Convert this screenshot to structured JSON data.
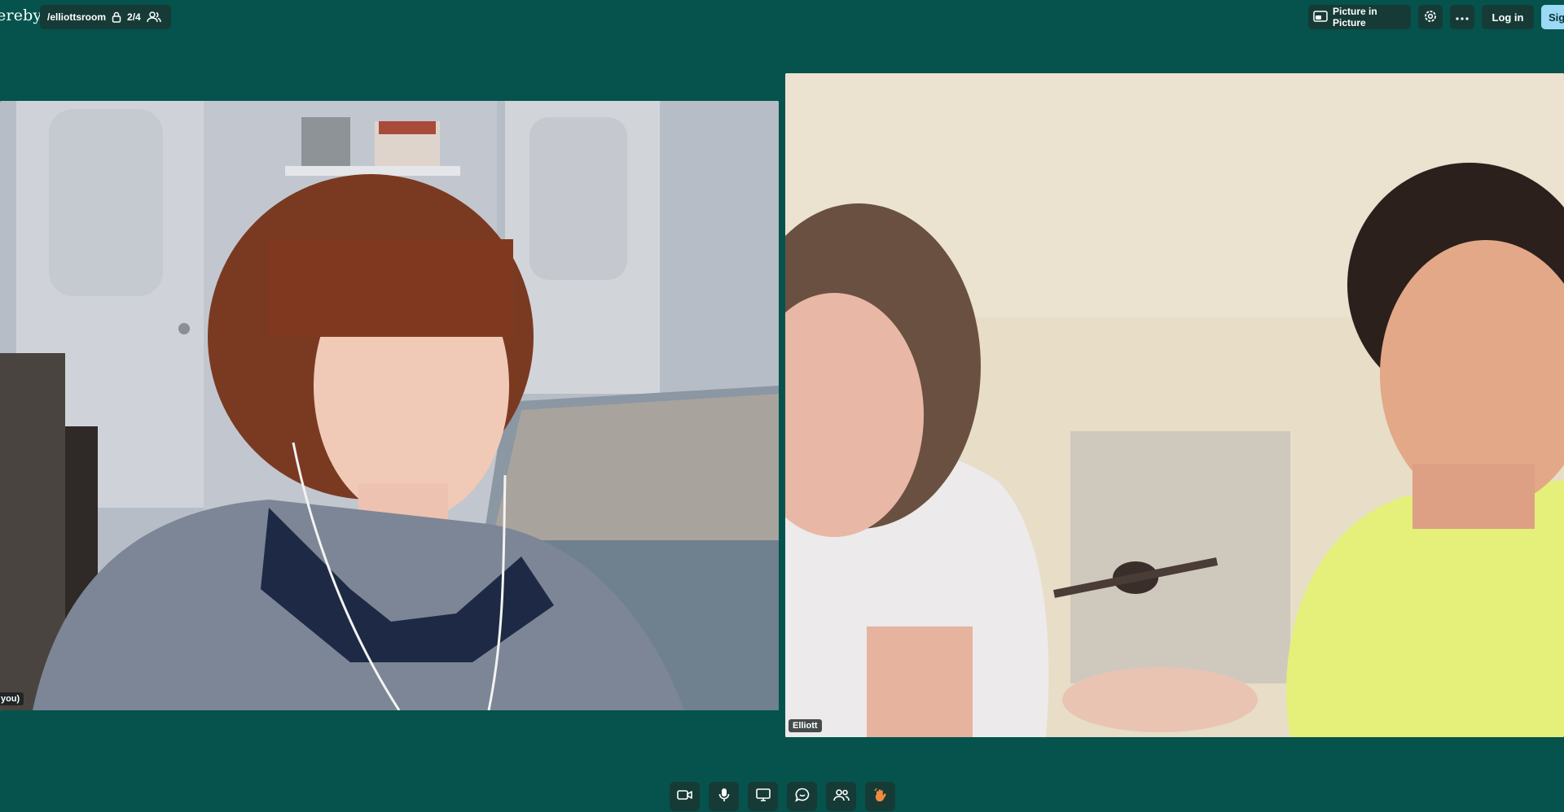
{
  "app": {
    "brand": "ereby"
  },
  "room": {
    "name": "/elliottsroom",
    "participants": "2/4"
  },
  "toolbar": {
    "pip_label": "Picture in Picture",
    "login_label": "Log in",
    "signup_label": "Sig"
  },
  "tiles": {
    "local_label": "you)",
    "remote_label": "Elliott"
  },
  "controls": {
    "camera": "camera-icon",
    "mic": "microphone-icon",
    "screen": "screen-share-icon",
    "chat": "chat-icon",
    "people": "people-icon",
    "react": "wave-hand-icon"
  },
  "colors": {
    "background": "#05534c",
    "button": "#163b37",
    "accent": "#9bd9f5",
    "react": "#f28a3d"
  }
}
